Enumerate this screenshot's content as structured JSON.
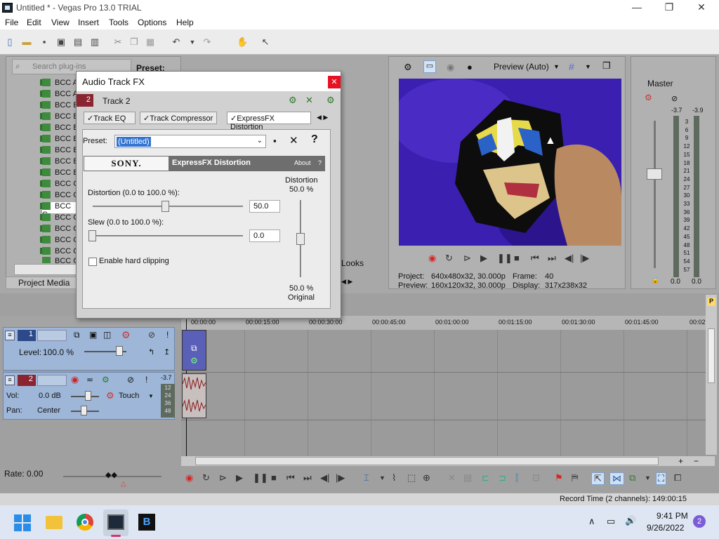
{
  "app": {
    "title": "Untitled * - Vegas Pro 13.0 TRIAL"
  },
  "window_controls": {
    "minimize": "—",
    "restore": "❐",
    "close": "✕"
  },
  "menu": [
    "File",
    "Edit",
    "View",
    "Insert",
    "Tools",
    "Options",
    "Help"
  ],
  "plugins": {
    "search_placeholder": "Search plug-ins",
    "preset_label": "Preset:",
    "items": [
      "BCC A",
      "BCC A",
      "BCC B",
      "BCC B",
      "BCC B",
      "BCC B",
      "BCC B",
      "BCC B",
      "BCC B",
      "BCC C",
      "BCC C",
      "BCC C",
      "BCC C",
      "BCC C",
      "BCC C",
      "BCC C",
      "BCC C"
    ],
    "looks_label": "Looks",
    "project_media_tab": "Project Media"
  },
  "preview": {
    "mode": "Preview (Auto)",
    "project_label": "Project:",
    "project_value": "640x480x32, 30.000p",
    "preview_label": "Preview:",
    "preview_value": "160x120x32, 30.000p",
    "frame_label": "Frame:",
    "frame_value": "40",
    "display_label": "Display:",
    "display_value": "317x238x32"
  },
  "master": {
    "label": "Master",
    "left_peak": "-3.7",
    "right_peak": "-3.9",
    "scale": [
      "3",
      "6",
      "9",
      "12",
      "15",
      "18",
      "21",
      "24",
      "27",
      "30",
      "33",
      "36",
      "39",
      "42",
      "45",
      "48",
      "51",
      "54",
      "57"
    ],
    "left_value": "0.0",
    "right_value": "0.0"
  },
  "timeline": {
    "ruler": [
      "00:00:00",
      "00:00:15:00",
      "00:00:30:00",
      "00:00:45:00",
      "00:01:00:00",
      "00:01:15:00",
      "00:01:30:00",
      "00:01:45:00",
      "00:02"
    ],
    "track1": {
      "number": "1",
      "level_label": "Level:",
      "level_value": "100.0 %"
    },
    "track2": {
      "number": "2",
      "vol_label": "Vol:",
      "vol_value": "0.0 dB",
      "pan_label": "Pan:",
      "pan_value": "Center",
      "touch": "Touch",
      "peak": "-3.7",
      "meter_scale": [
        "12",
        "24",
        "36",
        "48"
      ]
    },
    "rate_label": "Rate: 0.00",
    "record_time": "Record Time (2 channels): 149:00:15"
  },
  "dialog": {
    "title": "Audio Track FX",
    "track_number": "2",
    "track_label": "Track 2",
    "tabs": [
      "Track EQ",
      "Track Compressor",
      "ExpressFX Distortion"
    ],
    "preset_label": "Preset:",
    "preset_value": "(Untitled)",
    "help": "?",
    "sony": "SONY.",
    "plugin_name": "ExpressFX Distortion",
    "about": "About",
    "about_q": "?",
    "distortion_label": "Distortion (0.0 to 100.0 %):",
    "distortion_value": "50.0",
    "slew_label": "Slew (0.0 to 100.0 %):",
    "slew_value": "0.0",
    "hard_clip_label": "Enable hard clipping",
    "mix_top_title": "Distortion",
    "mix_top_value": "50.0 %",
    "mix_bottom_value": "50.0 %",
    "mix_bottom_title": "Original",
    "distortion_level": 0.5,
    "slew_level": 0.0,
    "mix_level": 0.5
  },
  "taskbar": {
    "time": "9:41 PM",
    "date": "9/26/2022",
    "notifications": "2"
  },
  "colors": {
    "accent_red": "#e81123",
    "track_blue": "#9eb7d8",
    "preview_purple": "#3b1fb0",
    "track_red": "#8a2430"
  }
}
